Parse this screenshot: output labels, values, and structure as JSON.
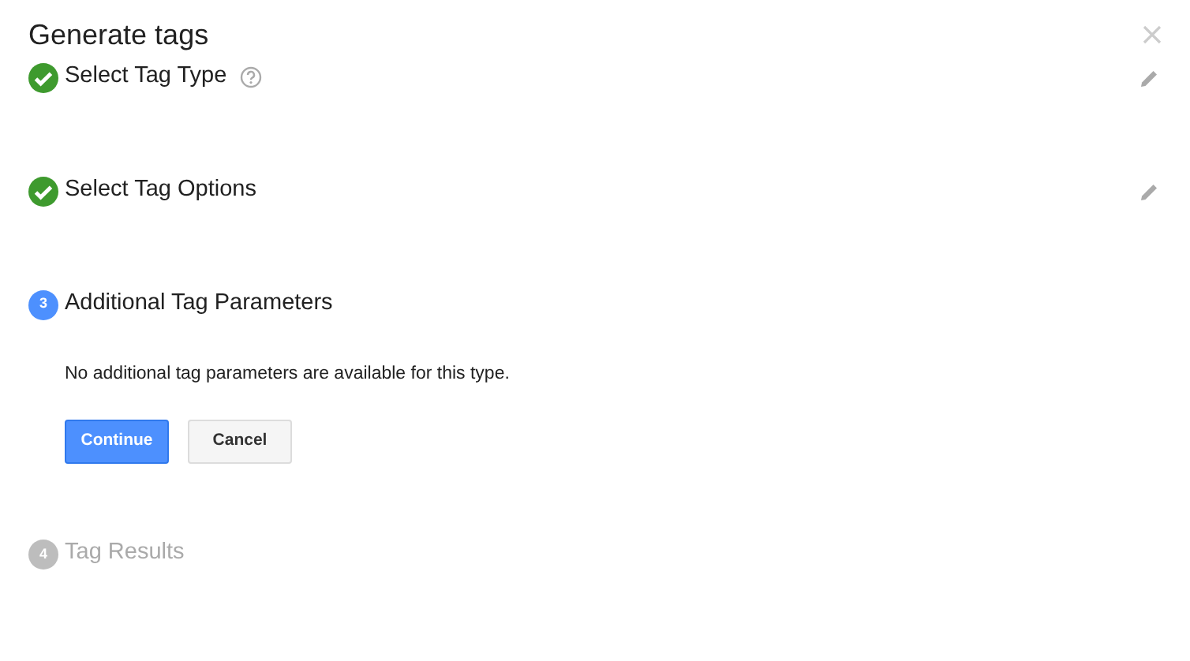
{
  "dialog": {
    "title": "Generate tags"
  },
  "steps": [
    {
      "title": "Select Tag Type",
      "kind": "done",
      "help": true,
      "editable": true
    },
    {
      "title": "Select Tag Options",
      "kind": "done",
      "help": false,
      "editable": true
    },
    {
      "title": "Additional Tag Parameters",
      "kind": "active",
      "number": "3",
      "help": false,
      "editable": false,
      "message": "No additional tag parameters are available for this type.",
      "buttons": [
        {
          "label": "Continue",
          "kind": "primary"
        },
        {
          "label": "Cancel",
          "kind": "secondary"
        }
      ]
    },
    {
      "title": "Tag Results",
      "kind": "pending",
      "number": "4",
      "help": false,
      "editable": false
    }
  ]
}
